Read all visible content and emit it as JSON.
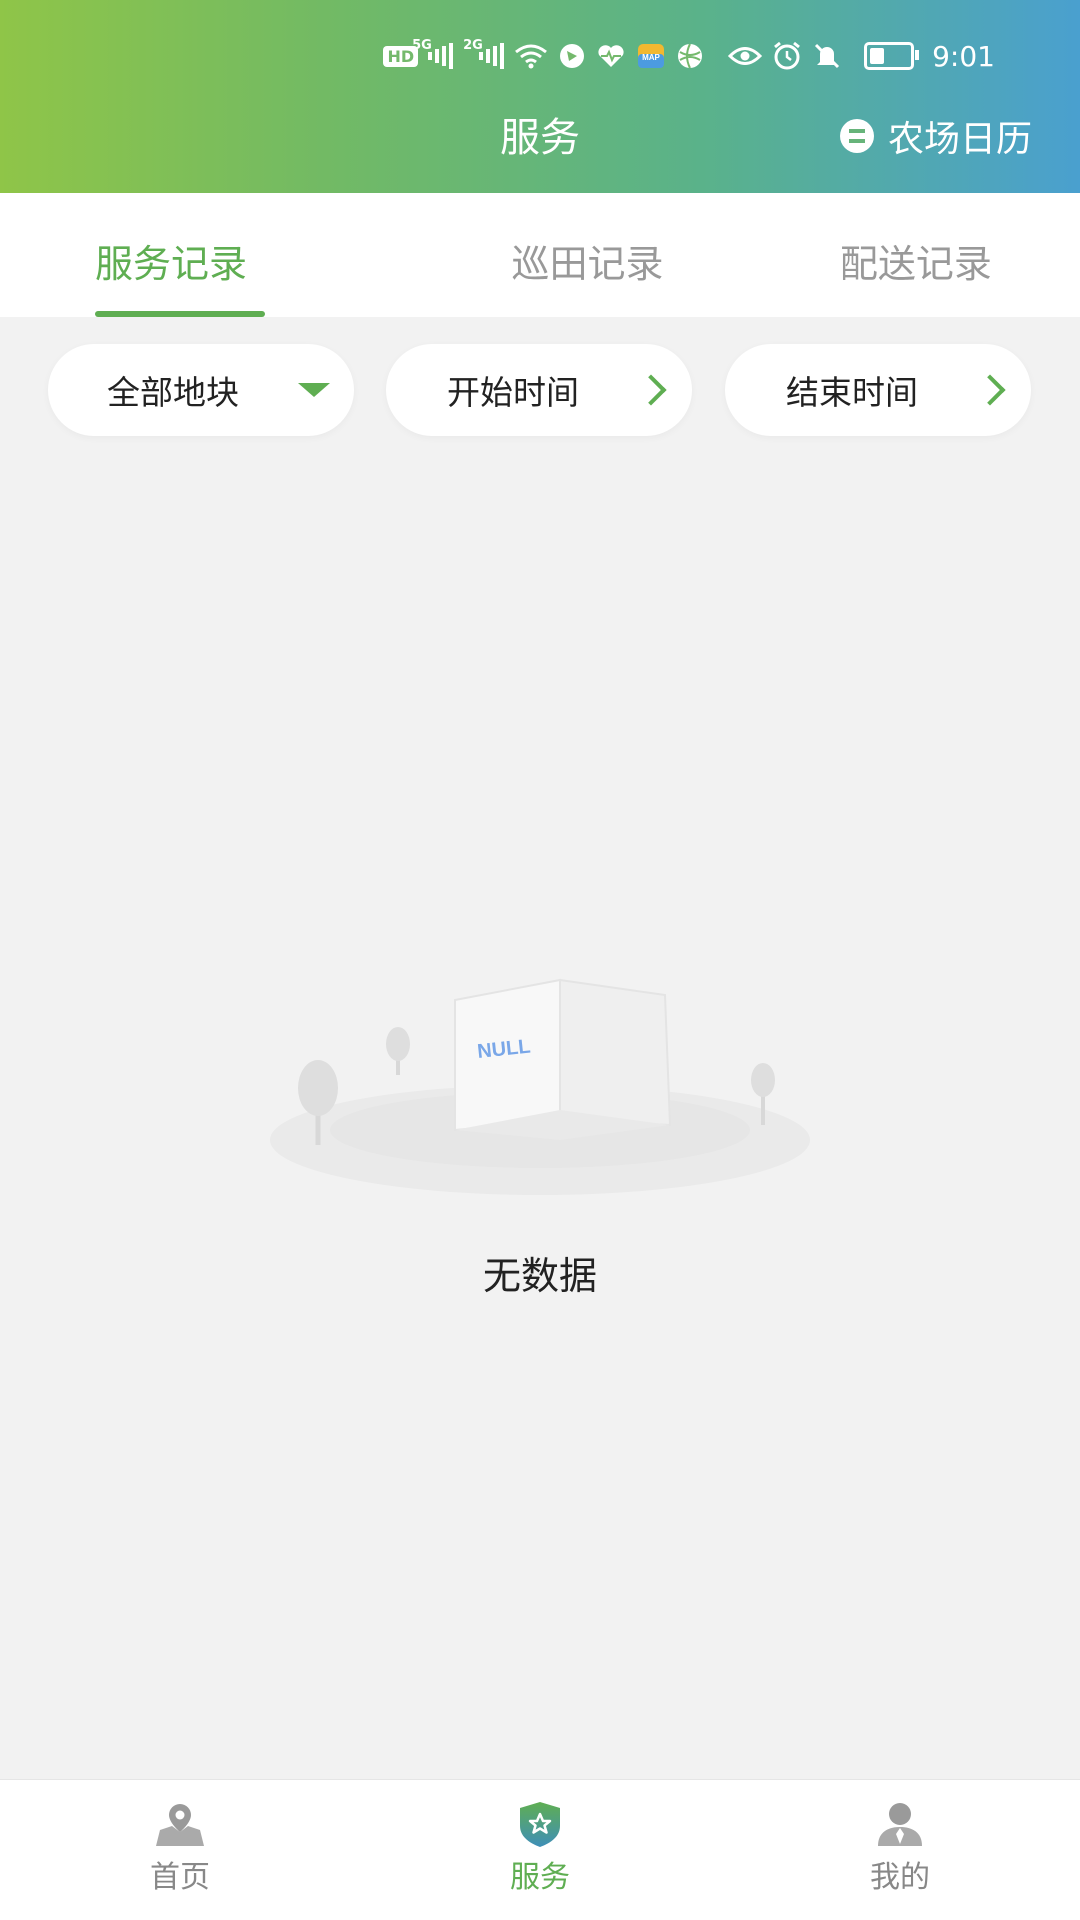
{
  "status_bar": {
    "icons": [
      "hd-icon",
      "signal-5g-icon",
      "signal-2g-icon",
      "wifi-icon",
      "app-icon",
      "heart-icon",
      "map-icon",
      "globe-icon",
      "eye-icon",
      "alarm-icon",
      "mute-icon",
      "battery-icon"
    ],
    "hd_label": "HD",
    "net_5g": "5G",
    "net_2g": "2G",
    "time": "9:01"
  },
  "header": {
    "title": "服务",
    "calendar_label": "农场日历"
  },
  "tabs": [
    {
      "label": "服务记录",
      "active": true
    },
    {
      "label": "巡田记录",
      "active": false
    },
    {
      "label": "配送记录",
      "active": false
    }
  ],
  "filters": {
    "plot": "全部地块",
    "start_time": "开始时间",
    "end_time": "结束时间"
  },
  "empty_state": {
    "illustration_text": "NULL",
    "message": "无数据"
  },
  "bottom_nav": [
    {
      "label": "首页",
      "icon": "map-pin-icon",
      "active": false
    },
    {
      "label": "服务",
      "icon": "shield-star-icon",
      "active": true
    },
    {
      "label": "我的",
      "icon": "user-icon",
      "active": false
    }
  ],
  "colors": {
    "accent": "#5fae52",
    "header_gradient_start": "#8fc548",
    "header_gradient_end": "#4aa0cf",
    "background": "#f2f2f2"
  }
}
